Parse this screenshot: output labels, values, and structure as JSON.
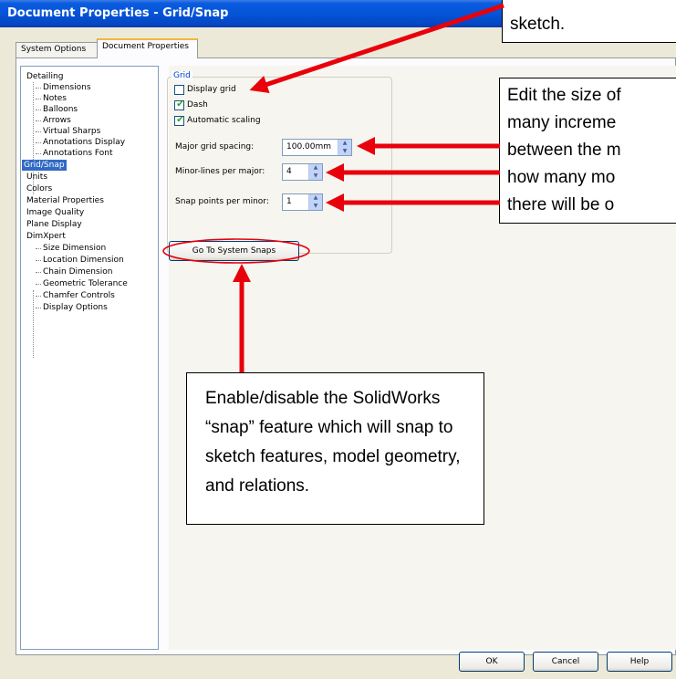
{
  "window": {
    "title": "Document Properties - Grid/Snap"
  },
  "tabs": [
    {
      "label": "System Options"
    },
    {
      "label": "Document Properties"
    }
  ],
  "tree": {
    "items": [
      {
        "label": "Detailing"
      },
      {
        "label": "Dimensions"
      },
      {
        "label": "Notes"
      },
      {
        "label": "Balloons"
      },
      {
        "label": "Arrows"
      },
      {
        "label": "Virtual Sharps"
      },
      {
        "label": "Annotations Display"
      },
      {
        "label": "Annotations Font"
      },
      {
        "label": "Grid/Snap"
      },
      {
        "label": "Units"
      },
      {
        "label": "Colors"
      },
      {
        "label": "Material Properties"
      },
      {
        "label": "Image Quality"
      },
      {
        "label": "Plane Display"
      },
      {
        "label": "DimXpert"
      },
      {
        "label": "Size Dimension"
      },
      {
        "label": "Location Dimension"
      },
      {
        "label": "Chain Dimension"
      },
      {
        "label": "Geometric Tolerance"
      },
      {
        "label": "Chamfer Controls"
      },
      {
        "label": "Display Options"
      }
    ],
    "selected": "Grid/Snap"
  },
  "grid": {
    "title": "Grid",
    "display_grid": {
      "label": "Display grid",
      "checked": false
    },
    "dash": {
      "label": "Dash",
      "checked": true
    },
    "automatic_scaling": {
      "label": "Automatic scaling",
      "checked": true
    },
    "major_spacing": {
      "label": "Major grid spacing:",
      "value": "100.00mm"
    },
    "minor_lines": {
      "label": "Minor-lines per major:",
      "value": "4"
    },
    "snap_points": {
      "label": "Snap points per minor:",
      "value": "1"
    }
  },
  "system_snaps_button": "Go To System Snaps",
  "footer": {
    "ok": "OK",
    "cancel": "Cancel",
    "help": "Help"
  },
  "annotations": {
    "top_callout": "sketch.",
    "right_callout": [
      "Edit the size of",
      "many increme",
      "between the m",
      "how many mo",
      "there will be o"
    ],
    "bottom_callout": [
      "Enable/disable the SolidWorks",
      "“snap” feature which will snap to",
      "sketch features, model geometry,",
      "and relations."
    ],
    "arrow_color": "#e8000b"
  },
  "icons": {
    "check": "check-icon",
    "spin_up": "spin-up-icon",
    "spin_down": "spin-down-icon"
  }
}
